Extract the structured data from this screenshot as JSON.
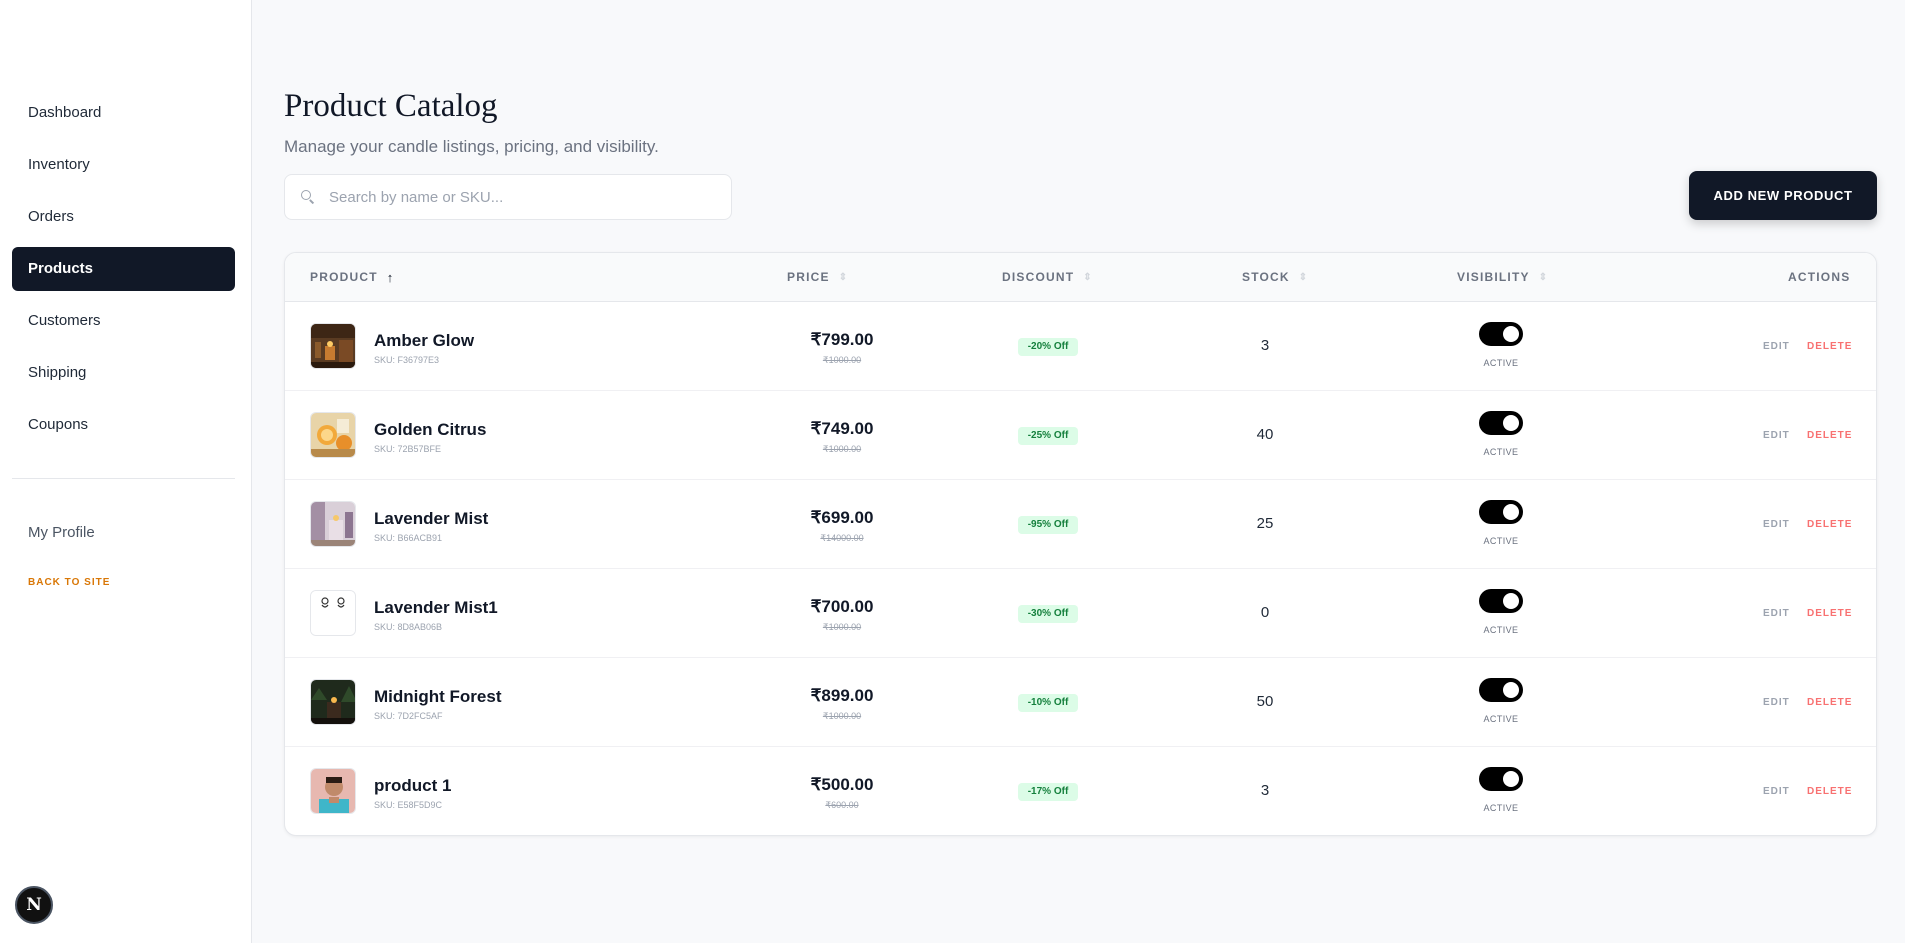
{
  "sidebar": {
    "items": [
      {
        "label": "Dashboard",
        "active": false
      },
      {
        "label": "Inventory",
        "active": false
      },
      {
        "label": "Orders",
        "active": false
      },
      {
        "label": "Products",
        "active": true
      },
      {
        "label": "Customers",
        "active": false
      },
      {
        "label": "Shipping",
        "active": false
      },
      {
        "label": "Coupons",
        "active": false
      }
    ],
    "profile_label": "My Profile",
    "back_label": "BACK TO SITE",
    "badge_letter": "N"
  },
  "header": {
    "title": "Product Catalog",
    "subtitle": "Manage your candle listings, pricing, and visibility."
  },
  "search": {
    "placeholder": "Search by name or SKU...",
    "value": ""
  },
  "add_button_label": "ADD NEW PRODUCT",
  "table": {
    "columns": {
      "product": "PRODUCT",
      "price": "PRICE",
      "discount": "DISCOUNT",
      "stock": "STOCK",
      "visibility": "VISIBILITY",
      "actions": "ACTIONS"
    },
    "rows": [
      {
        "name": "Amber Glow",
        "sku": "SKU: F36797E3",
        "price": "₹799.00",
        "old_price": "₹1000.00",
        "discount": "-20% Off",
        "stock": "3",
        "visibility": "ACTIVE",
        "edit": "EDIT",
        "delete": "DELETE"
      },
      {
        "name": "Golden Citrus",
        "sku": "SKU: 72B57BFE",
        "price": "₹749.00",
        "old_price": "₹1000.00",
        "discount": "-25% Off",
        "stock": "40",
        "visibility": "ACTIVE",
        "edit": "EDIT",
        "delete": "DELETE"
      },
      {
        "name": "Lavender Mist",
        "sku": "SKU: B66ACB91",
        "price": "₹699.00",
        "old_price": "₹14000.00",
        "discount": "-95% Off",
        "stock": "25",
        "visibility": "ACTIVE",
        "edit": "EDIT",
        "delete": "DELETE"
      },
      {
        "name": "Lavender Mist1",
        "sku": "SKU: 8D8AB06B",
        "price": "₹700.00",
        "old_price": "₹1000.00",
        "discount": "-30% Off",
        "stock": "0",
        "visibility": "ACTIVE",
        "edit": "EDIT",
        "delete": "DELETE"
      },
      {
        "name": "Midnight Forest",
        "sku": "SKU: 7D2FC5AF",
        "price": "₹899.00",
        "old_price": "₹1000.00",
        "discount": "-10% Off",
        "stock": "50",
        "visibility": "ACTIVE",
        "edit": "EDIT",
        "delete": "DELETE"
      },
      {
        "name": "product 1",
        "sku": "SKU: E58F5D9C",
        "price": "₹500.00",
        "old_price": "₹600.00",
        "discount": "-17% Off",
        "stock": "3",
        "visibility": "ACTIVE",
        "edit": "EDIT",
        "delete": "DELETE"
      }
    ]
  },
  "colors": {
    "primary": "#111827",
    "accent_back": "#d97706",
    "discount_bg": "#dcfce7",
    "discount_text": "#15803d",
    "delete": "#f87171"
  }
}
